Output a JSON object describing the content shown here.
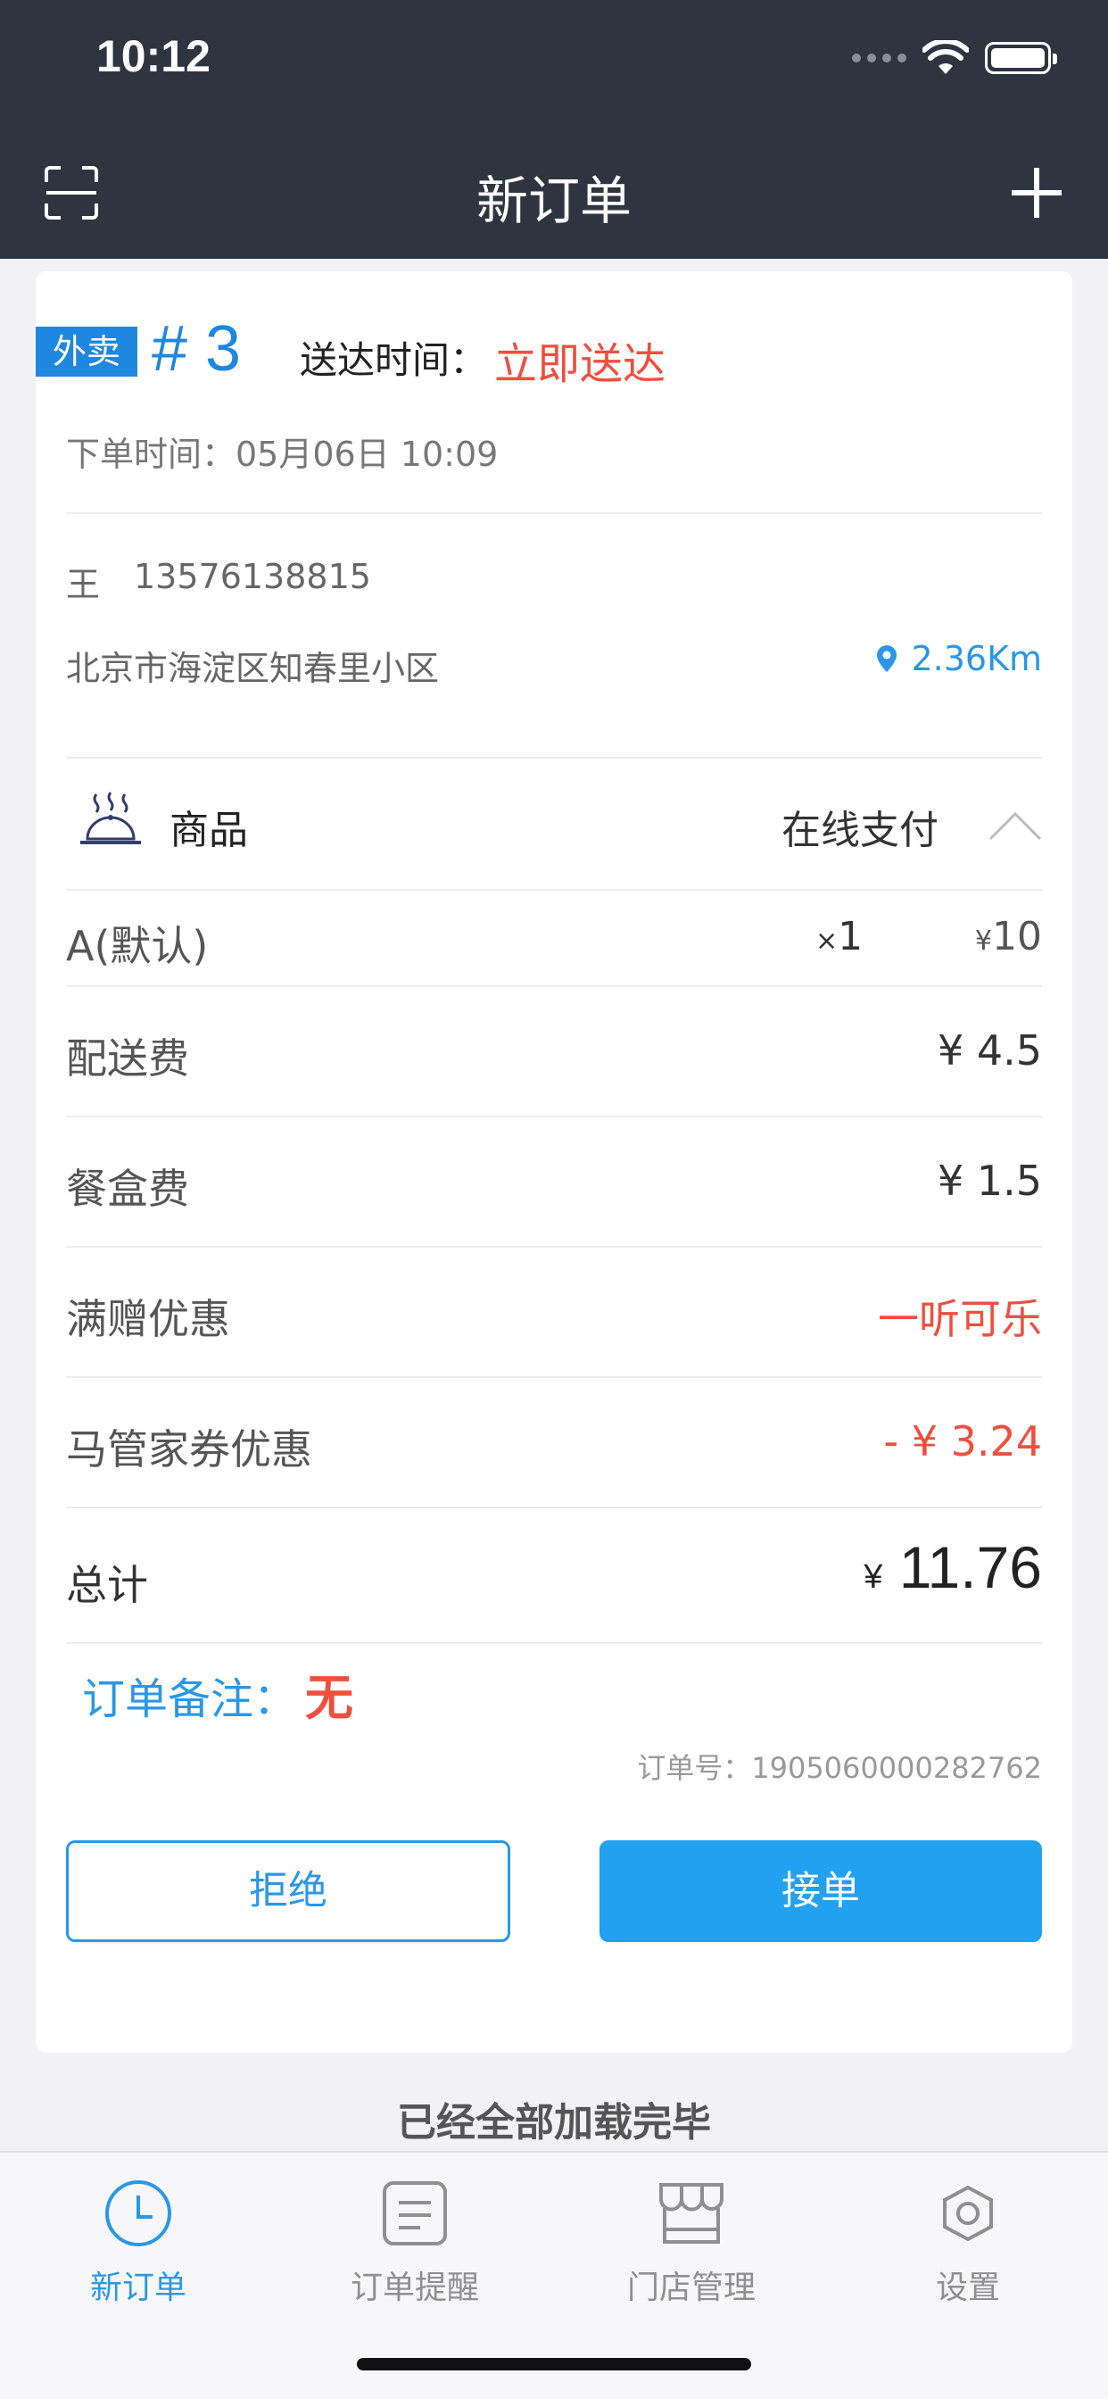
{
  "status_bar": {
    "time": "10:12"
  },
  "nav": {
    "title": "新订单"
  },
  "order": {
    "tag": "外卖",
    "number": "# 3",
    "deliver_label": "送达时间：",
    "deliver_value": "立即送达",
    "order_time": "下单时间：05月06日 10:09",
    "customer_name": "王",
    "customer_phone": "13576138815",
    "address": "北京市海淀区知春里小区",
    "distance": "2.36Km",
    "goods_label": "商品",
    "payment": "在线支付",
    "items": [
      {
        "name": "A(默认)",
        "qty_prefix": "×",
        "qty": "1",
        "price_prefix": "¥",
        "price": "10"
      }
    ],
    "fees": [
      {
        "label": "配送费",
        "value": "¥ 4.5"
      },
      {
        "label": "餐盒费",
        "value": "¥ 1.5"
      },
      {
        "label": "满赠优惠",
        "value": "一听可乐"
      },
      {
        "label": "马管家券优惠",
        "value": "- ¥ 3.24"
      }
    ],
    "total_label": "总计",
    "total_prefix": "¥",
    "total_value": "11.76",
    "remark_label": "订单备注：",
    "remark_value": "无",
    "order_id": "订单号：1905060000282762",
    "reject_label": "拒绝",
    "accept_label": "接单"
  },
  "list_footer": "已经全部加载完毕",
  "tabbar": {
    "tabs": [
      {
        "label": "新订单",
        "icon": "clock-icon",
        "active": true
      },
      {
        "label": "订单提醒",
        "icon": "document-icon",
        "active": false
      },
      {
        "label": "门店管理",
        "icon": "store-icon",
        "active": false
      },
      {
        "label": "设置",
        "icon": "gear-icon",
        "active": false
      }
    ]
  },
  "colors": {
    "header_bg": "#2f3441",
    "accent": "#2a97e8",
    "tag_bg": "#1f87e0",
    "alert": "#f04e3e"
  }
}
